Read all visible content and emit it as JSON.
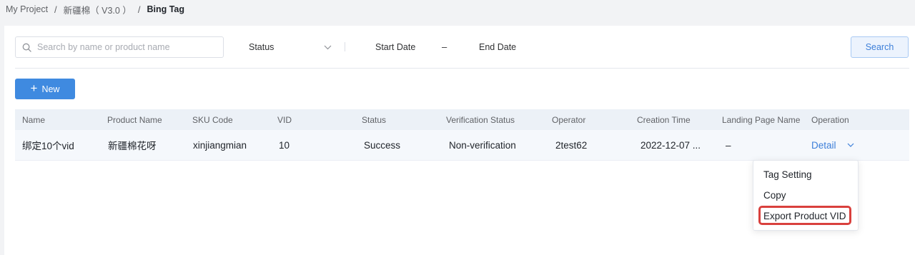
{
  "breadcrumb": {
    "items": [
      "My Project",
      "新疆棉（ V3.0 ）",
      "Bing Tag"
    ],
    "separator": "/"
  },
  "filters": {
    "search_placeholder": "Search by name or product name",
    "status_label": "Status",
    "start_date_placeholder": "Start Date",
    "date_separator": "–",
    "end_date_placeholder": "End Date",
    "search_button": "Search"
  },
  "actions": {
    "new_label": "New"
  },
  "table": {
    "columns": [
      "Name",
      "Product Name",
      "SKU Code",
      "VID",
      "Status",
      "Verification Status",
      "Operator",
      "Creation Time",
      "Landing Page Name",
      "Operation"
    ],
    "rows": [
      {
        "name": "绑定10个vid",
        "product_name": "新疆棉花呀",
        "sku_code": "xinjiangmian",
        "vid": "10",
        "status": "Success",
        "verification_status": "Non-verification",
        "operator": "2test62",
        "creation_time": "2022-12-07 ...",
        "landing_page_name": "–",
        "operation": "Detail"
      }
    ]
  },
  "dropdown": {
    "items": [
      "Tag Setting",
      "Copy",
      "Export Product VID"
    ],
    "highlighted_item": "Export Product VID"
  },
  "colors": {
    "primary": "#3f8ae0",
    "link": "#3d7fd9",
    "highlight_border": "#d9403d"
  }
}
